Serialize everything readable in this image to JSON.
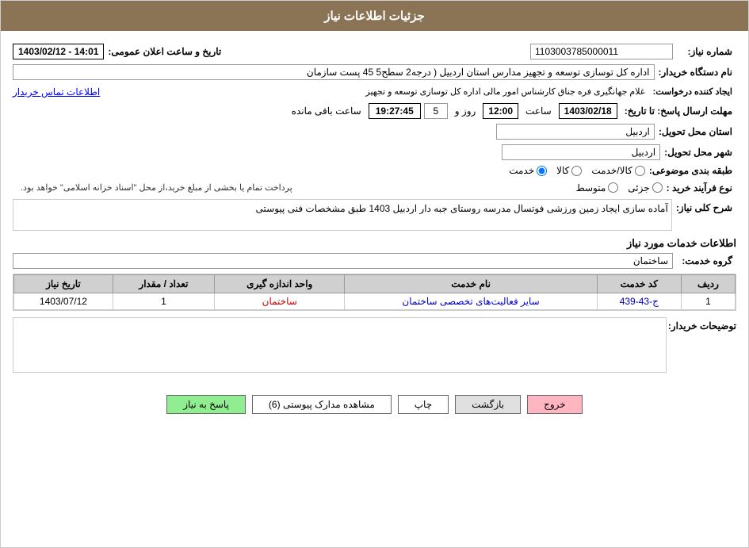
{
  "header": {
    "title": "جزئیات اطلاعات نیاز"
  },
  "fields": {
    "shomara_niaz_label": "شماره نیاز:",
    "shomara_niaz_value": "1103003785000011",
    "tarikh_label": "تاریخ و ساعت اعلان عمومی:",
    "tarikh_value": "1403/02/12 - 14:01",
    "naam_dastgah_label": "نام دستگاه خریدار:",
    "naam_dastgah_value": "اداره کل توسازی   توسعه و تجهیز مدارس استان اردبیل ( درجه2  سطح5  45 پست سازمان",
    "ijad_label": "ایجاد کننده درخواست:",
    "ijad_value": "غلام جهانگیری فره جناق کارشناس امور مالی اداره کل توسازی   توسعه و تجهیز",
    "ijad_link": "اطلاعات تماس خریدار",
    "mohlat_label": "مهلت ارسال پاسخ: تا تاریخ:",
    "mohlat_date": "1403/02/18",
    "mohlat_saat_label": "ساعت",
    "mohlat_saat": "12:00",
    "mohlat_rooz_label": "روز و",
    "mohlat_rooz": "5",
    "mohlat_countdown": "19:27:45",
    "mohlat_countdown_label": "ساعت باقی مانده",
    "ostan_label": "استان محل تحویل:",
    "ostan_value": "اردبیل",
    "shahr_label": "شهر محل تحویل:",
    "shahr_value": "اردبیل",
    "tabaqe_label": "طبقه بندی موضوعی:",
    "tabaqe_kala": "کالا",
    "tabaqe_khadamat": "خدمت",
    "tabaqe_kala_khadamat": "کالا/خدمت",
    "now_farayand_label": "نوع فرآیند خرید :",
    "now_jazii": "جزئی",
    "now_motavassit": "متوسط",
    "notice": "پرداخت تمام یا بخشی از مبلغ خرید،از محل \"اسناد خزانه اسلامی\" خواهد بود.",
    "sharh_label": "شرح کلی نیاز:",
    "sharh_value": "آماده سازی ایجاد زمین ورزشی فوتسال مدرسه روستای جبه دار اردبیل 1403 طبق مشخصات فنی پیوستی",
    "section_title": "اطلاعات خدمات مورد نیاز",
    "goroh_label": "گروه خدمت:",
    "goroh_value": "ساختمان",
    "table": {
      "headers": [
        "ردیف",
        "کد خدمت",
        "نام خدمت",
        "واحد اندازه گیری",
        "تعداد / مقدار",
        "تاریخ نیاز"
      ],
      "rows": [
        {
          "radif": "1",
          "kod": "ج-43-439",
          "naam": "سایر فعالیت‌های تخصصی ساختمان",
          "vahed": "ساختمان",
          "tedad": "1",
          "tarikh": "1403/07/12"
        }
      ]
    },
    "tawzih_label": "توضیحات خریدار:",
    "tawzih_value": ""
  },
  "buttons": {
    "pasokh": "پاسخ به نیاز",
    "moshahedeh": "مشاهده مدارک پیوستی (6)",
    "chap": "چاپ",
    "bazgasht": "بازگشت",
    "khoroj": "خروج"
  }
}
